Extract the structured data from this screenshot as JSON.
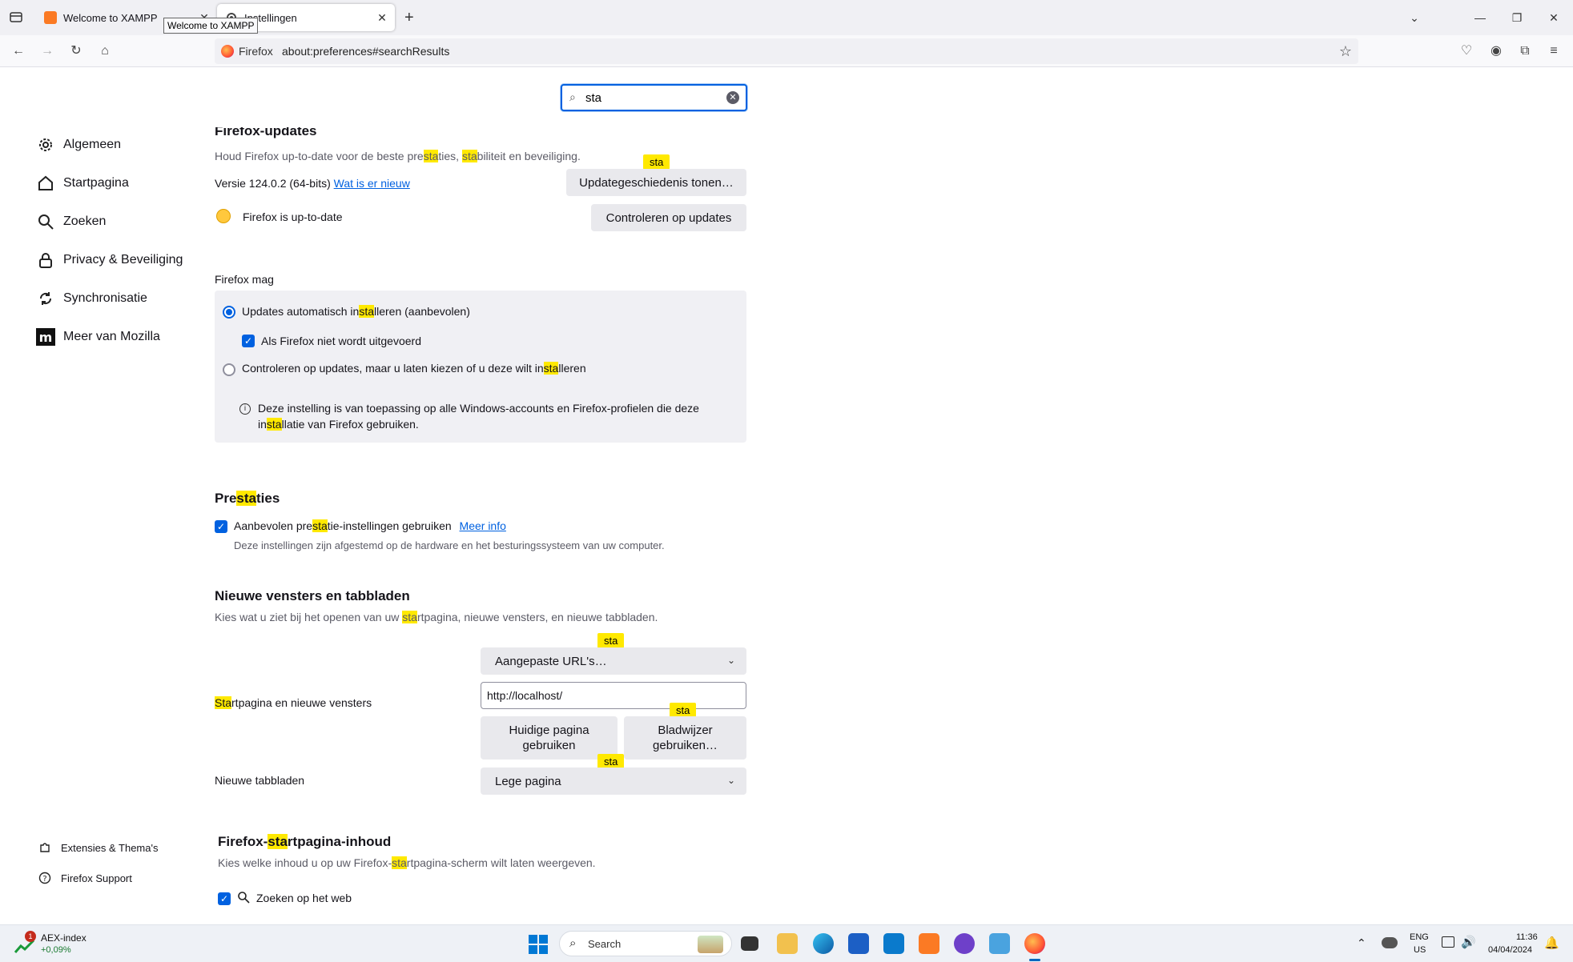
{
  "browser": {
    "tabs": [
      {
        "label": "Welcome to XAMPP"
      },
      {
        "label": "Instellingen"
      }
    ],
    "tooltip": "Welcome to XAMPP",
    "identity_label": "Firefox",
    "url": "about:preferences#searchResults"
  },
  "search": {
    "value": "sta"
  },
  "sidebar": {
    "items": [
      {
        "label": "Algemeen"
      },
      {
        "label": "Startpagina"
      },
      {
        "label": "Zoeken"
      },
      {
        "label": "Privacy & Beveiliging"
      },
      {
        "label": "Synchronisatie"
      },
      {
        "label": "Meer van Mozilla"
      }
    ],
    "footer": [
      {
        "label": "Extensies & Thema's"
      },
      {
        "label": "Firefox Support"
      }
    ]
  },
  "updates": {
    "heading": "Firefox-updates",
    "desc_1": "Houd Firefox up-to-date voor de beste pre",
    "desc_hl_1": "sta",
    "desc_2": "ties, ",
    "desc_hl_2": "sta",
    "desc_3": "biliteit en beveiliging.",
    "version": "Versie 124.0.2 (64-bits)",
    "whats_new": "Wat is er nieuw",
    "history_button": "Updategeschiedenis tonen…",
    "status": "Firefox is up-to-date",
    "check_button": "Controleren op updates",
    "allow_label": "Firefox mag",
    "opt_auto_1": "Updates automatisch in",
    "opt_auto_hl": "sta",
    "opt_auto_2": "lleren (aanbevolen)",
    "opt_when_closed": "Als Firefox niet wordt uitgevoerd",
    "opt_manual_1": "Controleren op updates, maar u laten kiezen of u deze wilt in",
    "opt_manual_hl": "sta",
    "opt_manual_2": "lleren",
    "info_1": "Deze instelling is van toepassing op alle Windows-accounts en Firefox-profielen die deze",
    "info_2a": "in",
    "info_2hl": "sta",
    "info_2b": "llatie van Firefox gebruiken."
  },
  "performance": {
    "heading_1": "Pre",
    "heading_hl": "sta",
    "heading_2": "ties",
    "check_1": "Aanbevolen pre",
    "check_hl": "sta",
    "check_2": "tie-instellingen gebruiken",
    "more_info": "Meer info",
    "desc": "Deze instellingen zijn afgestemd op de hardware en het besturingssysteem van uw computer."
  },
  "windows": {
    "heading": "Nieuwe vensters en tabbladen",
    "desc_1": "Kies wat u ziet bij het openen van uw ",
    "desc_hl": "sta",
    "desc_2": "rtpagina, nieuwe vensters, en nieuwe tabbladen.",
    "home_label_hl": "Sta",
    "home_label": "rtpagina en nieuwe vensters",
    "home_select": "Aangepaste URL's…",
    "home_url": "http://localhost/",
    "use_current": "Huidige pagina gebruiken",
    "use_bookmark": "Bladwijzer gebruiken…",
    "newtab_label": "Nieuwe tabbladen",
    "newtab_select": "Lege pagina",
    "bubble": "sta"
  },
  "home_content": {
    "heading_1": "Firefox-",
    "heading_hl": "sta",
    "heading_2": "rtpagina-inhoud",
    "desc_1": "Kies welke inhoud u op uw Firefox-",
    "desc_hl": "sta",
    "desc_2": "rtpagina-scherm wilt laten weergeven.",
    "web_search": "Zoeken op het web"
  },
  "taskbar": {
    "widget_title": "AEX-index",
    "widget_value": "+0,09%",
    "widget_badge": "1",
    "search_label": "Search",
    "lang_1": "ENG",
    "lang_2": "US",
    "time": "11:36",
    "date": "04/04/2024"
  },
  "colors": {
    "highlight": "#ffe900",
    "accent": "#0061e0"
  }
}
